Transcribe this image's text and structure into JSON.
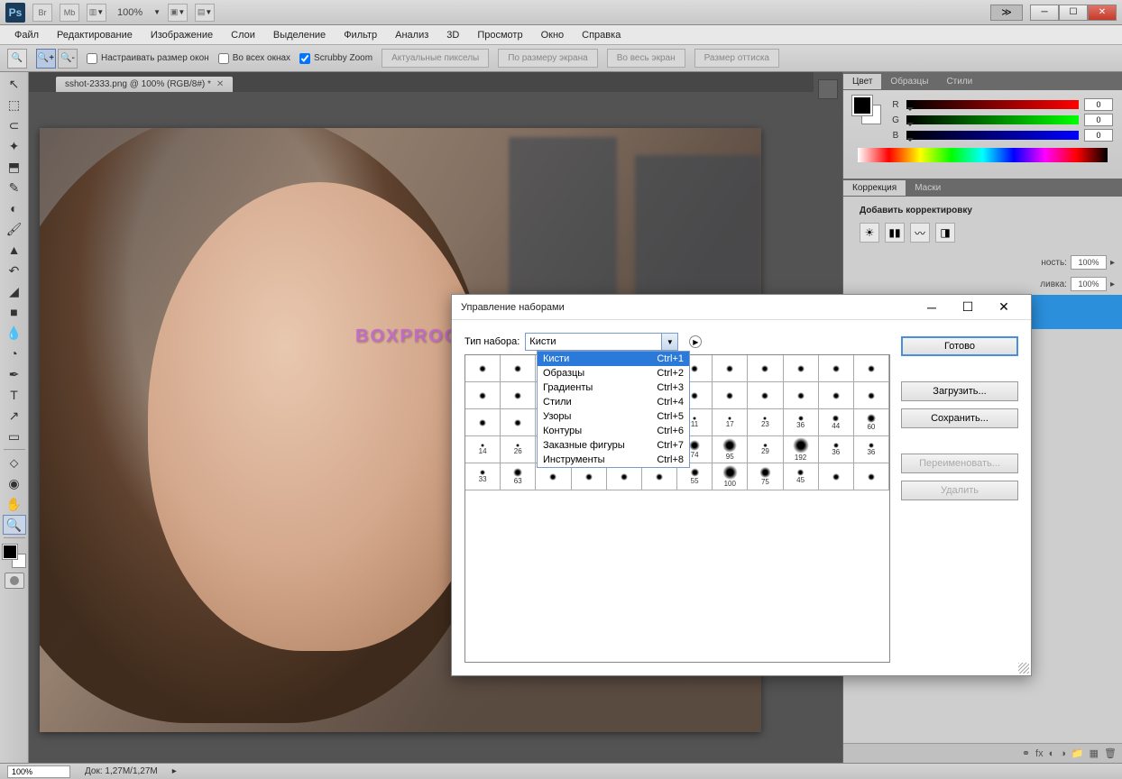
{
  "top": {
    "zoom": "100%"
  },
  "menu": [
    "Файл",
    "Редактирование",
    "Изображение",
    "Слои",
    "Выделение",
    "Фильтр",
    "Анализ",
    "3D",
    "Просмотр",
    "Окно",
    "Справка"
  ],
  "options": {
    "cb1": "Настраивать размер окон",
    "cb2": "Во всех окнах",
    "cb3": "Scrubby Zoom",
    "btn1": "Актуальные пикселы",
    "btn2": "По размеру экрана",
    "btn3": "Во весь экран",
    "btn4": "Размер оттиска"
  },
  "doc_tab": "sshot-2333.png @ 100% (RGB/8#) *",
  "watermark": "BOXPROGRAMS.RU",
  "color_panel": {
    "tabs": [
      "Цвет",
      "Образцы",
      "Стили"
    ],
    "r": "R",
    "g": "G",
    "b": "B",
    "r_val": "0",
    "g_val": "0",
    "b_val": "0"
  },
  "adj_panel": {
    "tabs": [
      "Коррекция",
      "Маски"
    ],
    "header": "Добавить корректировку"
  },
  "layers": {
    "opacity_label": "ность:",
    "fill_label": "ливка:",
    "opacity": "100%",
    "fill": "100%"
  },
  "status": {
    "zoom": "100%",
    "doc_label": "Док:",
    "doc_size": "1,27М/1,27М"
  },
  "dialog": {
    "title": "Управление наборами",
    "type_label": "Тип набора:",
    "selected": "Кисти",
    "options": [
      {
        "label": "Кисти",
        "key": "Ctrl+1"
      },
      {
        "label": "Образцы",
        "key": "Ctrl+2"
      },
      {
        "label": "Градиенты",
        "key": "Ctrl+3"
      },
      {
        "label": "Стили",
        "key": "Ctrl+4"
      },
      {
        "label": "Узоры",
        "key": "Ctrl+5"
      },
      {
        "label": "Контуры",
        "key": "Ctrl+6"
      },
      {
        "label": "Заказные фигуры",
        "key": "Ctrl+7"
      },
      {
        "label": "Инструменты",
        "key": "Ctrl+8"
      }
    ],
    "btn_done": "Готово",
    "btn_load": "Загрузить...",
    "btn_save": "Сохранить...",
    "btn_rename": "Переименовать...",
    "btn_delete": "Удалить",
    "brush_sizes_row3": [
      "11",
      "17",
      "23",
      "36",
      "44",
      "60"
    ],
    "brush_sizes_row4": [
      "14",
      "26",
      "",
      "",
      "",
      "",
      "74",
      "95",
      "29",
      "192",
      "36",
      "36"
    ],
    "brush_sizes_row5": [
      "33",
      "63",
      "",
      "",
      "",
      "",
      "55",
      "100",
      "75",
      "45"
    ]
  }
}
